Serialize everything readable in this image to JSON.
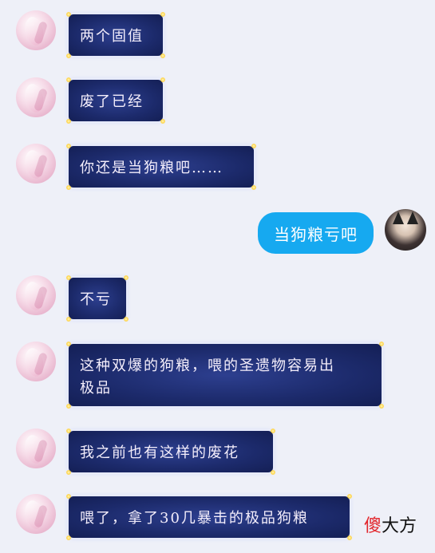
{
  "messages": [
    {
      "side": "left",
      "text": "两个固值"
    },
    {
      "side": "left",
      "text": "废了已经"
    },
    {
      "side": "left",
      "text": "你还是当狗粮吧……"
    },
    {
      "side": "right",
      "text": "当狗粮亏吧"
    },
    {
      "side": "left",
      "text": "不亏"
    },
    {
      "side": "left",
      "text_line1": "这种双爆的狗粮，喂的圣遗物容易出",
      "text_line2": "极品"
    },
    {
      "side": "left",
      "text": "我之前也有这样的废花"
    },
    {
      "side": "left",
      "text": "喂了，拿了30几暴击的极品狗粮"
    }
  ],
  "watermark": {
    "part1": "傻",
    "part2": "大方"
  },
  "colors": {
    "night_bubble": "#1c2a6b",
    "blue_bubble": "#16a9f0",
    "background": "#eef0f8"
  }
}
